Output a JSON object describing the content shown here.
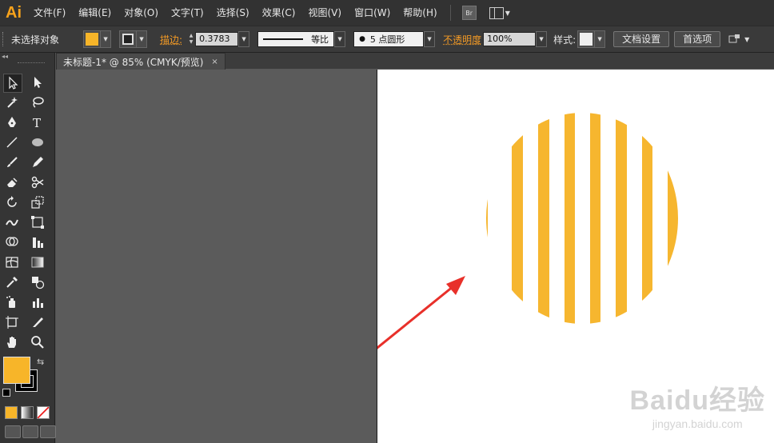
{
  "app": {
    "logo": "Ai",
    "br_badge": "Br"
  },
  "menu": [
    "文件(F)",
    "编辑(E)",
    "对象(O)",
    "文字(T)",
    "选择(S)",
    "效果(C)",
    "视图(V)",
    "窗口(W)",
    "帮助(H)"
  ],
  "control_bar": {
    "selection_status": "未选择对象",
    "stroke_label": "描边:",
    "stroke_weight": "0.3783",
    "stroke_profile": "等比",
    "brush_definition": "5 点圆形",
    "opacity_label": "不透明度",
    "opacity_value": "100%",
    "style_label": "样式:",
    "doc_setup_button": "文档设置",
    "preferences_button": "首选项"
  },
  "document": {
    "tab_title": "未标题-1* @ 85% (CMYK/预览)",
    "tab_close": "×"
  },
  "colors": {
    "fill": "#f7b529",
    "stripe": "#f6b62f",
    "arrow": "#e8302a"
  },
  "artwork": {
    "shape": "striped-circle",
    "stripe_count": 8
  },
  "watermark": {
    "main": "Baidu经验",
    "sub": "jingyan.baidu.com"
  }
}
